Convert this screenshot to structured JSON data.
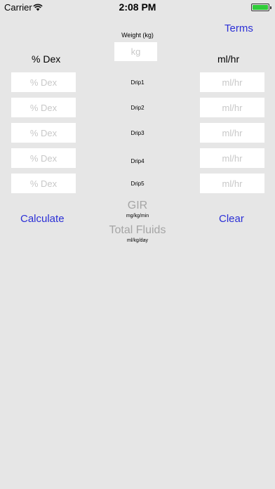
{
  "status_bar": {
    "carrier": "Carrier",
    "time": "2:08 PM",
    "battery_color": "#2fcc39"
  },
  "header": {
    "terms_label": "Terms",
    "weight_label": "Weight (kg)",
    "weight_placeholder": "kg",
    "dex_header": "% Dex",
    "rate_header": "ml/hr"
  },
  "drips": [
    {
      "label": "Drip1",
      "dex_placeholder": "% Dex",
      "rate_placeholder": "ml/hr"
    },
    {
      "label": "Drip2",
      "dex_placeholder": "% Dex",
      "rate_placeholder": "ml/hr"
    },
    {
      "label": "Drip3",
      "dex_placeholder": "% Dex",
      "rate_placeholder": "ml/hr"
    },
    {
      "label": "Drip4",
      "dex_placeholder": "% Dex",
      "rate_placeholder": "ml/hr"
    },
    {
      "label": "Drip5",
      "dex_placeholder": "% Dex",
      "rate_placeholder": "ml/hr"
    }
  ],
  "results": {
    "gir_label": "GIR",
    "gir_unit": "mg/kg/min",
    "fluids_label": "Total Fluids",
    "fluids_unit": "ml/kg/day"
  },
  "actions": {
    "calculate_label": "Calculate",
    "clear_label": "Clear",
    "accent_color": "#2b2fd6"
  }
}
